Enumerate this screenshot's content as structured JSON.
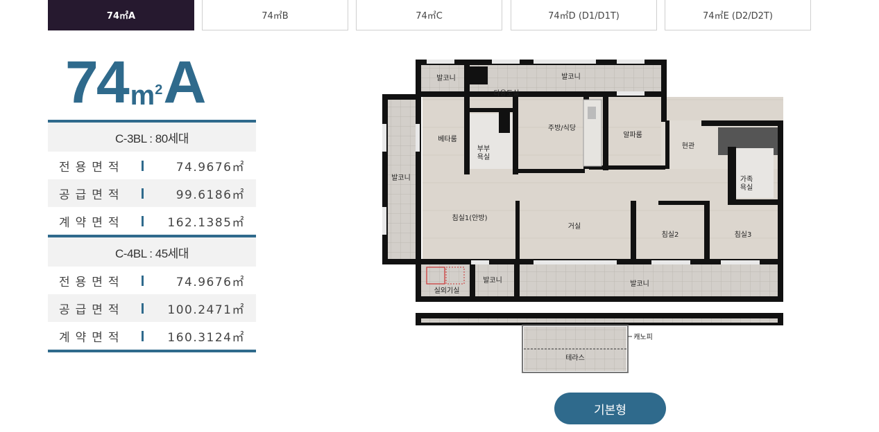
{
  "tabs": [
    {
      "label": "74㎡A",
      "active": true
    },
    {
      "label": "74㎡B",
      "active": false
    },
    {
      "label": "74㎡C",
      "active": false
    },
    {
      "label": "74㎡D (D1/D1T)",
      "active": false
    },
    {
      "label": "74㎡E (D2/D2T)",
      "active": false
    }
  ],
  "title": {
    "number": "74",
    "unit": "m",
    "unit_sup": "2",
    "type": "A"
  },
  "blocks": [
    {
      "heading": "C-3BL : 80세대",
      "rows": [
        {
          "label": "전용면적",
          "value": "74.9676㎡"
        },
        {
          "label": "공급면적",
          "value": "99.6186㎡"
        },
        {
          "label": "계약면적",
          "value": "162.1385㎡"
        }
      ]
    },
    {
      "heading": "C-4BL : 45세대",
      "rows": [
        {
          "label": "전용면적",
          "value": "74.9676㎡"
        },
        {
          "label": "공급면적",
          "value": "100.2471㎡"
        },
        {
          "label": "계약면적",
          "value": "160.3124㎡"
        }
      ]
    }
  ],
  "floorplan": {
    "rooms": {
      "balcony_top_left": "발코니",
      "balcony_top": "발코니",
      "utility": "다용도실",
      "beta_room": "베타룸",
      "couple_bath": "부부\n욕실",
      "kitchen": "주방/식당",
      "alpha_room": "알파룸",
      "entrance": "현관",
      "balcony_left": "발코니",
      "family_bath": "가족\n욕실",
      "master_bedroom": "침실1(안방)",
      "living_room": "거실",
      "bedroom2": "침실2",
      "bedroom3": "침실3",
      "outdoor_unit": "실외기실",
      "balcony_bottom_small": "발코니",
      "balcony_bottom": "발코니",
      "canopy": "캐노피",
      "terrace": "테라스"
    },
    "colors": {
      "wall": "#111111",
      "floor": "#d9d3cb",
      "tile": "#cfcac4"
    }
  },
  "basic_button_label": "기본형",
  "colors": {
    "accent": "#2f6a8c",
    "active_tab": "#26192f"
  }
}
